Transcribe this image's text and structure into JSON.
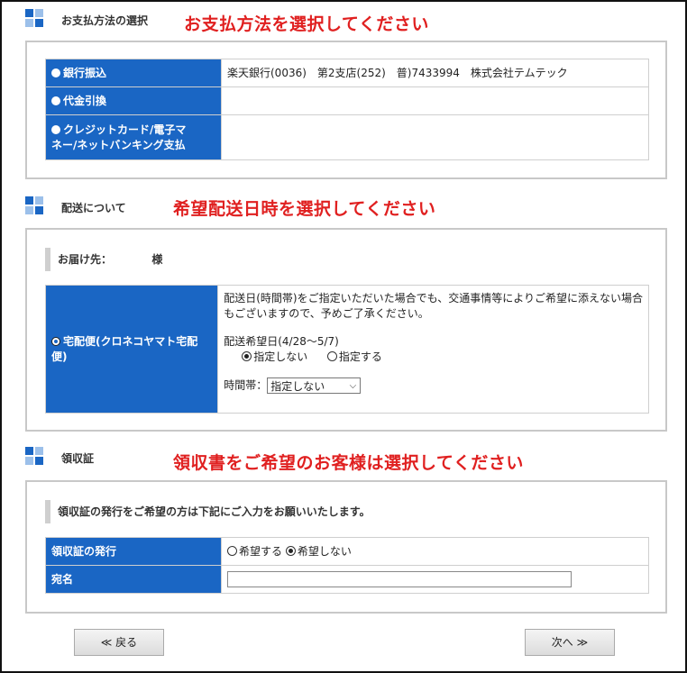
{
  "payment": {
    "title": "お支払方法の選択",
    "note": "お支払方法を選択してください",
    "options": [
      {
        "label": "銀行振込",
        "detail": "楽天銀行(0036)　第2支店(252)　普)7433994　株式会社テムテック",
        "selected": false
      },
      {
        "label": "代金引換",
        "detail": "",
        "selected": false
      },
      {
        "label_line1": "クレジットカード/電子マ",
        "label_line2": "ネー/ネットバンキング支払",
        "detail": "",
        "selected": false
      }
    ]
  },
  "delivery": {
    "title": "配送について",
    "note": "希望配送日時を選択してください",
    "recipient_label": "お届け先：",
    "recipient_suffix": "様",
    "method_line1": "宅配便(クロネコヤマト宅配",
    "method_line2": "便)",
    "notice_line1": "配送日(時間帯)をご指定いただいた場合でも、交通事情等によりご希望に添えない場合",
    "notice_line2": "もございますので、予めご了承ください。",
    "date_label": "配送希望日(4/28～5/7)",
    "date_option_none": "指定しない",
    "date_option_specify": "指定する",
    "time_label": "時間帯：",
    "time_selected": "指定しない"
  },
  "receipt": {
    "title": "領収証",
    "note": "領収書をご希望のお客様は選択してください",
    "instruction": "領収証の発行をご希望の方は下記にご入力をお願いいたします。",
    "issue_label": "領収証の発行",
    "issue_yes": "希望する",
    "issue_no": "希望しない",
    "addressee_label": "宛名",
    "addressee_value": ""
  },
  "nav": {
    "back": "≪ 戻る",
    "next": "次へ ≫"
  }
}
